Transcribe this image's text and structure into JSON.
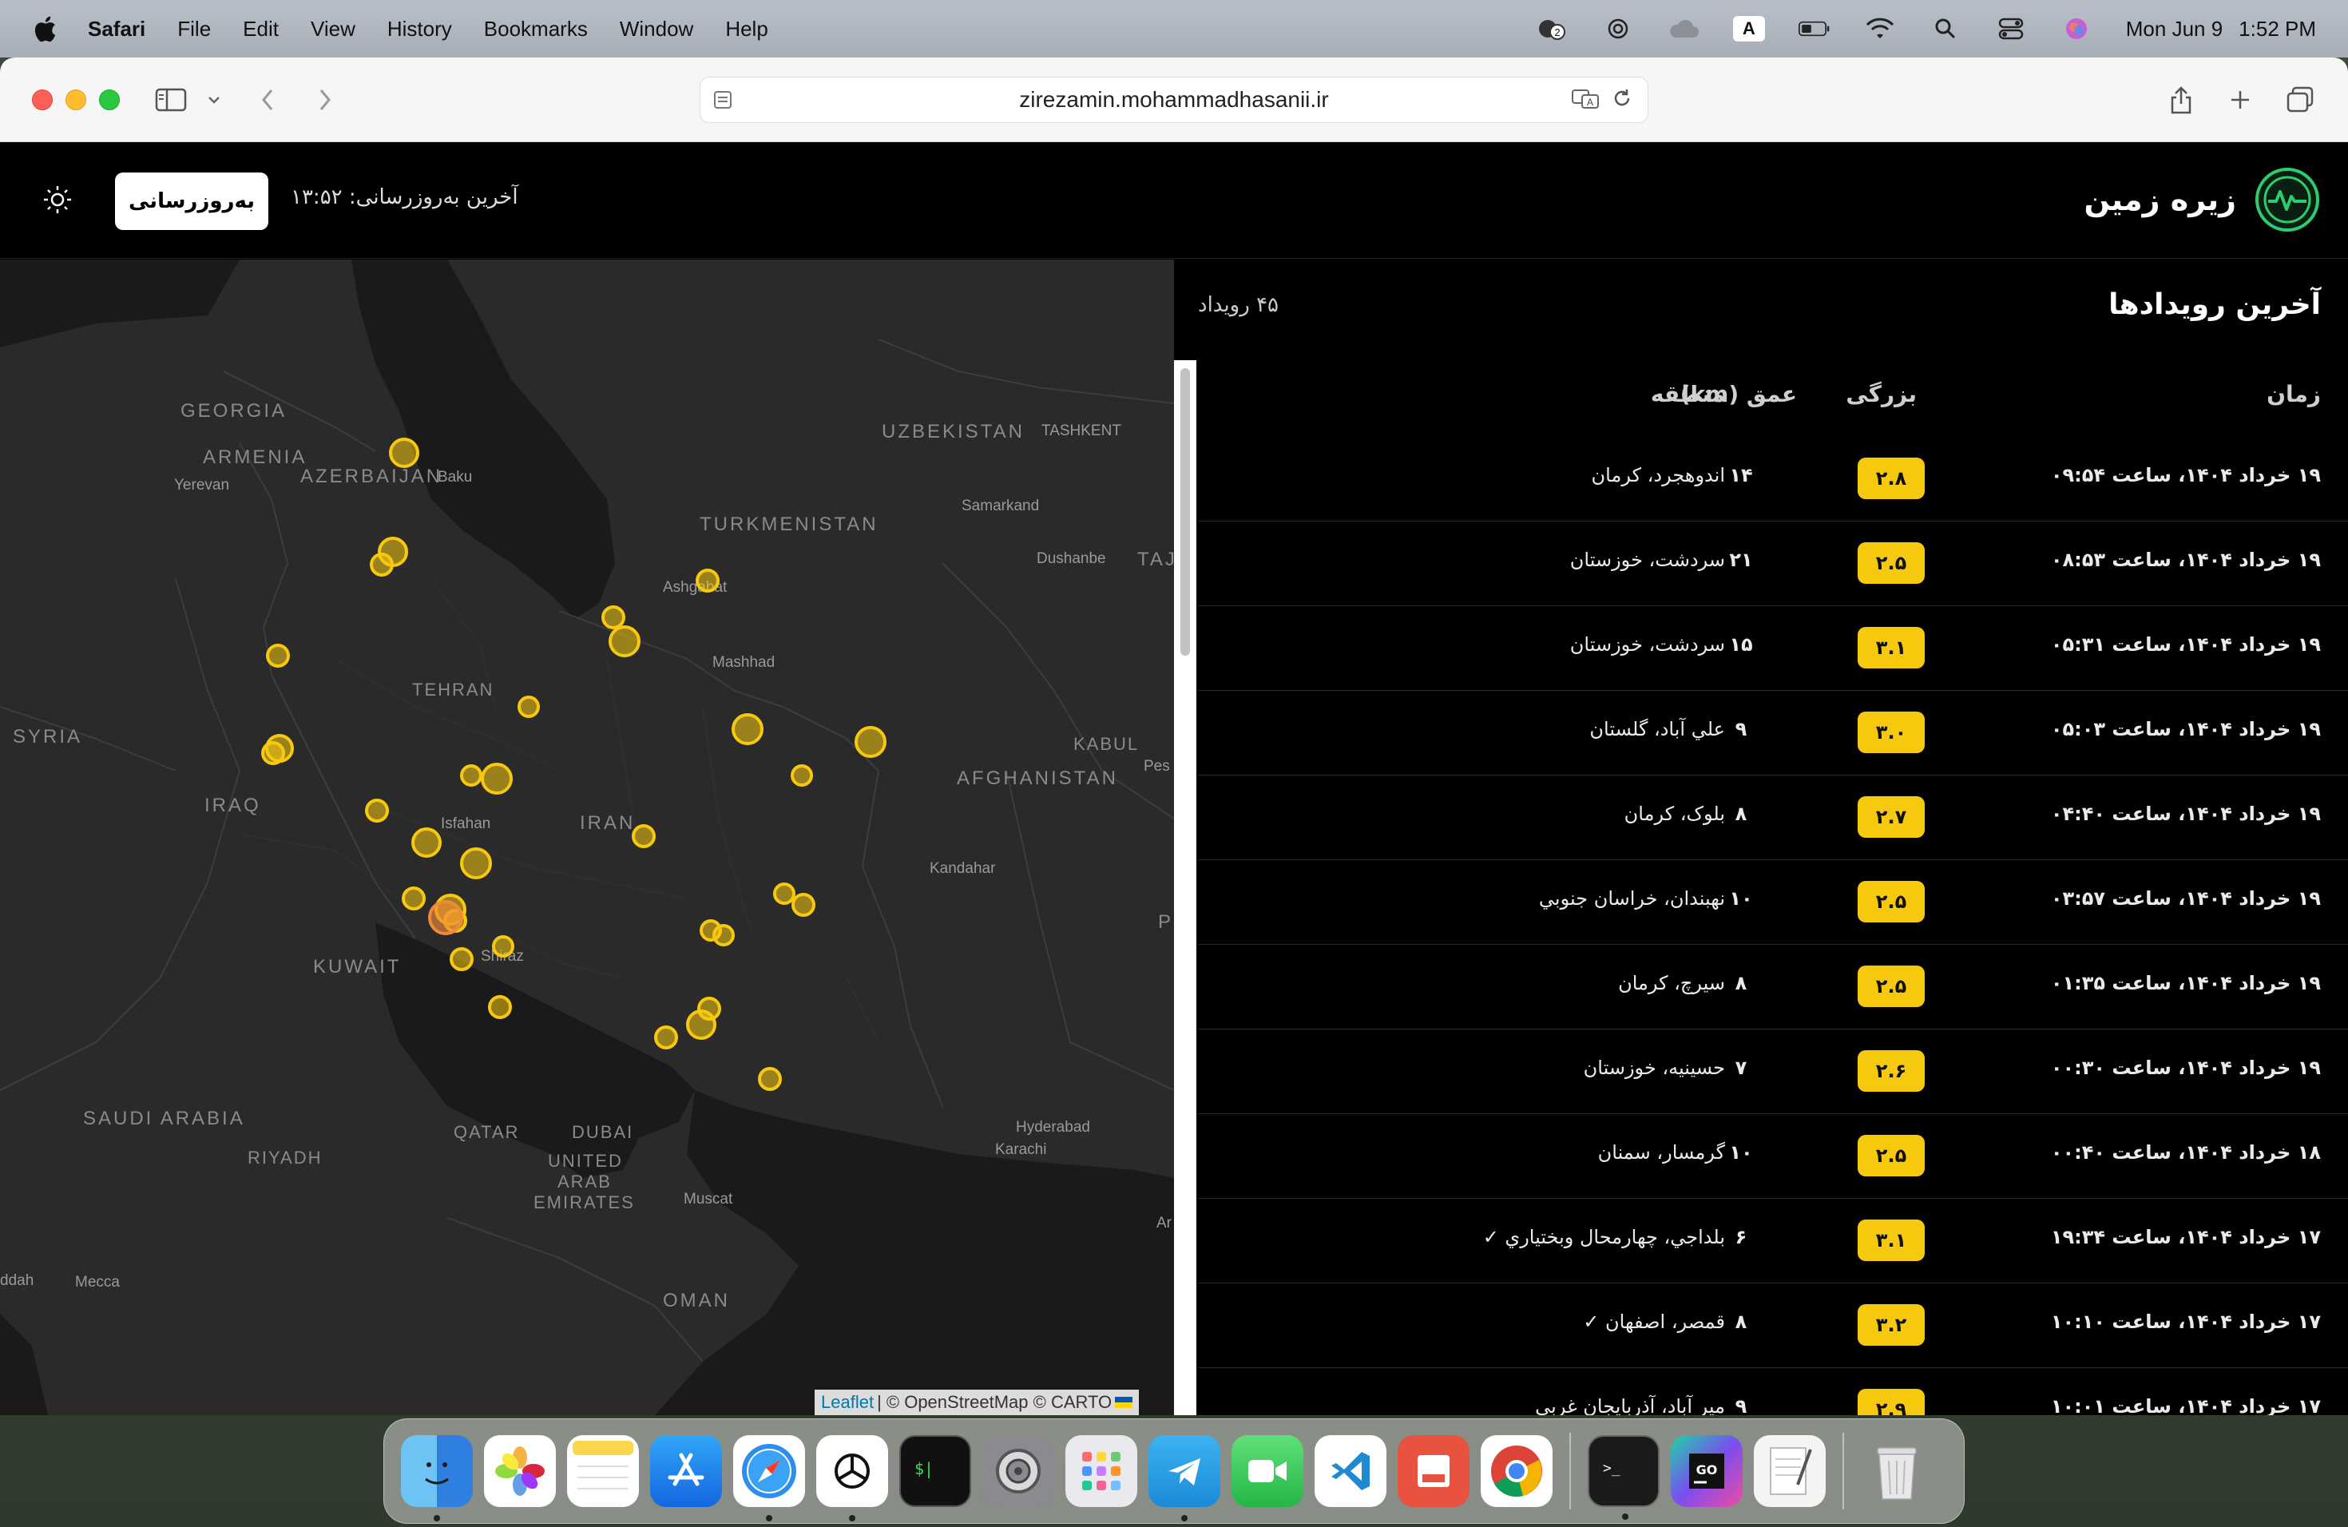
{
  "menubar": {
    "app_name": "Safari",
    "items": [
      "File",
      "Edit",
      "View",
      "History",
      "Bookmarks",
      "Window",
      "Help"
    ],
    "date": "Mon Jun 9",
    "time": "1:52 PM",
    "input_source": "A",
    "notification_count": "2"
  },
  "browser": {
    "url": "zirezamin.mohammadhasanii.ir"
  },
  "site": {
    "brand_title": "زیره زمین",
    "refresh_label": "به‌روزرسانی",
    "last_update": "آخرین به‌روزرسانی: ۱۳:۵۲"
  },
  "map": {
    "labels": {
      "georgia": "GEORGIA",
      "armenia": "ARMENIA",
      "yerevan": "Yerevan",
      "azerbaijan": "AZERBAIJAN",
      "baku": "Baku",
      "uzbekistan": "UZBEKISTAN",
      "tashkent": "TASHKENT",
      "turkmenistan": "TURKMENISTAN",
      "samarkand": "Samarkand",
      "dushanbe": "Dushanbe",
      "taj": "TAJ",
      "ashgabat": "Ashgabat",
      "mashhad": "Mashhad",
      "tehran": "TEHRAN",
      "syria": "SYRIA",
      "kabul": "KABUL",
      "pes": "Pes",
      "afghanistan": "AFGHANISTAN",
      "iraq": "IRAQ",
      "isfahan": "Isfahan",
      "iran": "IRAN",
      "kandahar": "Kandahar",
      "kuwait": "KUWAIT",
      "shiraz": "Shiraz",
      "p": "P",
      "saudi": "SAUDI ARABIA",
      "riyadh": "RIYADH",
      "qatar": "QATAR",
      "dubai": "DUBAI",
      "uae1": "UNITED",
      "uae2": "ARAB",
      "uae3": "EMIRATES",
      "hyderabad": "Hyderabad",
      "karachi": "Karachi",
      "muscat": "Muscat",
      "jeddah": "ddah",
      "mecca": "Mecca",
      "oman": "OMAN",
      "ar": "Ar"
    },
    "zoom_in": "+",
    "zoom_out": "−",
    "attribution_link": "Leaflet",
    "attribution_text": "| © OpenStreetMap © CARTO"
  },
  "events": {
    "title": "آخرین رویدادها",
    "count": "۴۵ رویداد",
    "columns": {
      "time": "زمان",
      "magnitude": "بزرگی",
      "depth": "عمق (km)",
      "region": "منطقه"
    },
    "rows": [
      {
        "time": "۱۹ خرداد ۱۴۰۴، ساعت ۰۹:۵۴",
        "magnitude": "۲.۸",
        "depth": "۱۴",
        "region": "اندوهجرد، کرمان"
      },
      {
        "time": "۱۹ خرداد ۱۴۰۴، ساعت ۰۸:۵۳",
        "magnitude": "۲.۵",
        "depth": "۲۱",
        "region": "سردشت، خوزستان"
      },
      {
        "time": "۱۹ خرداد ۱۴۰۴، ساعت ۰۵:۳۱",
        "magnitude": "۳.۱",
        "depth": "۱۵",
        "region": "سردشت، خوزستان"
      },
      {
        "time": "۱۹ خرداد ۱۴۰۴، ساعت ۰۵:۰۳",
        "magnitude": "۳.۰",
        "depth": "۹",
        "region": "علي آباد، گلستان"
      },
      {
        "time": "۱۹ خرداد ۱۴۰۴، ساعت ۰۴:۴۰",
        "magnitude": "۲.۷",
        "depth": "۸",
        "region": "بلوک، کرمان"
      },
      {
        "time": "۱۹ خرداد ۱۴۰۴، ساعت ۰۳:۵۷",
        "magnitude": "۲.۵",
        "depth": "۱۰",
        "region": "نهبندان، خراسان جنوبي"
      },
      {
        "time": "۱۹ خرداد ۱۴۰۴، ساعت ۰۱:۳۵",
        "magnitude": "۲.۵",
        "depth": "۸",
        "region": "سيرچ، کرمان"
      },
      {
        "time": "۱۹ خرداد ۱۴۰۴، ساعت ۰۰:۳۰",
        "magnitude": "۲.۶",
        "depth": "۷",
        "region": "حسينيه، خوزستان"
      },
      {
        "time": "۱۸ خرداد ۱۴۰۴، ساعت ۰۰:۴۰",
        "magnitude": "۲.۵",
        "depth": "۱۰",
        "region": "گرمسار، سمنان"
      },
      {
        "time": "۱۷ خرداد ۱۴۰۴، ساعت ۱۹:۳۴",
        "magnitude": "۳.۱",
        "depth": "۶",
        "region": "بلداجي، چهارمحال وبختياري ✓"
      },
      {
        "time": "۱۷ خرداد ۱۴۰۴، ساعت ۱۰:۱۰",
        "magnitude": "۳.۲",
        "depth": "۸",
        "region": "قمصر، اصفهان ✓"
      },
      {
        "time": "۱۷ خرداد ۱۴۰۴، ساعت ۱۰:۰۱",
        "magnitude": "۲.۹",
        "depth": "۹",
        "region": "مير آباد، آذربايجان غربي"
      }
    ]
  },
  "colors": {
    "accent_yellow": "#f6c90e",
    "brand_green": "#2ecc71",
    "highlight_orange": "#f08a3a"
  },
  "dock": {
    "apps": [
      "Finder",
      "Photos",
      "Notes",
      "App Store",
      "Safari",
      "ChatGPT",
      "Terminal Dev",
      "System Settings",
      "Launchpad",
      "Telegram",
      "FaceTime",
      "Visual Studio Code",
      "Mockup",
      "Chrome",
      "Terminal",
      "GoLand",
      "TextEdit",
      "Trash"
    ]
  }
}
